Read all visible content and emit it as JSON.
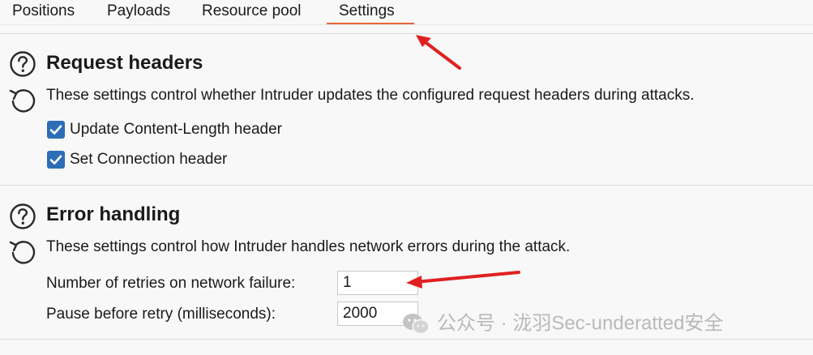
{
  "tabs": [
    {
      "label": "Positions"
    },
    {
      "label": "Payloads"
    },
    {
      "label": "Resource pool"
    },
    {
      "label": "Settings",
      "active": true
    }
  ],
  "request_headers": {
    "title": "Request headers",
    "description": "These settings control whether Intruder updates the configured request headers during attacks.",
    "options": [
      {
        "label": "Update Content-Length header",
        "checked": true
      },
      {
        "label": "Set Connection header",
        "checked": true
      }
    ]
  },
  "error_handling": {
    "title": "Error handling",
    "description": "These settings control how Intruder handles network errors during the attack.",
    "retries_label": "Number of retries on network failure:",
    "retries_value": "1",
    "pause_label": "Pause before retry (milliseconds):",
    "pause_value": "2000"
  },
  "watermark": {
    "text": "公众号 · 泷羽Sec-underatted安全"
  },
  "colors": {
    "accent": "#e8663a",
    "checkbox": "#2d6db5",
    "annotation_arrow": "#e02020"
  }
}
